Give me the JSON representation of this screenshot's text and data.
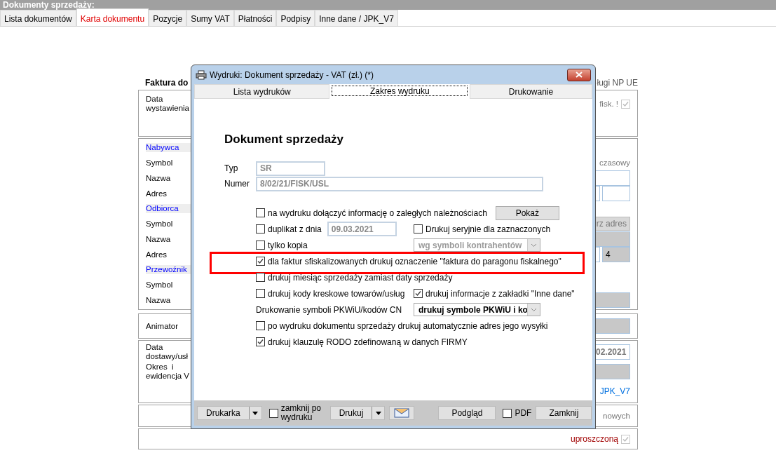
{
  "background": {
    "title": "Dokumenty sprzedaży:",
    "tabs": [
      {
        "label": "Lista dokumentów",
        "selected": false
      },
      {
        "label": "Karta dokumentu",
        "selected": true
      },
      {
        "label": "Pozycje",
        "selected": false
      },
      {
        "label": "Sumy VAT",
        "selected": false
      },
      {
        "label": "Płatności",
        "selected": false
      },
      {
        "label": "Podpisy",
        "selected": false
      },
      {
        "label": "Inne dane / JPK_V7",
        "selected": false
      }
    ],
    "form_title": "Faktura do",
    "form_note": "ługi NP UE",
    "groups": [
      {
        "rows": [
          {
            "label": "Data wystawienia",
            "right": {
              "kind": "check",
              "text": "fisk. !",
              "checked": true
            }
          }
        ]
      },
      {
        "rows": [
          {
            "label": "Nabywca",
            "heading": true
          },
          {
            "label": "Symbol",
            "right": {
              "kind": "text",
              "text": "czasowy"
            }
          },
          {
            "label": "Nazwa",
            "right": {
              "kind": "field"
            }
          },
          {
            "label": "Adres",
            "right": {
              "kind": "pair"
            }
          },
          {
            "label": "Odbiorca",
            "heading": true
          },
          {
            "label": "Symbol",
            "right": {
              "kind": "button",
              "text": "rz adres"
            }
          },
          {
            "label": "Nazwa",
            "right": {
              "kind": "gray"
            }
          },
          {
            "label": "Adres",
            "right": {
              "kind": "pair",
              "text": "4"
            }
          },
          {
            "label": "Przewoźnik",
            "heading": true
          },
          {
            "label": "Symbol"
          },
          {
            "label": "Nazwa",
            "right": {
              "kind": "gray"
            }
          }
        ]
      },
      {
        "rows": [
          {
            "label": "Animator",
            "right": {
              "kind": "gray"
            }
          }
        ]
      },
      {
        "rows": [
          {
            "label": "Data dostawy/usł",
            "right": {
              "kind": "field",
              "text": "02.2021"
            }
          },
          {
            "label": "Okres  i ewidencja V",
            "right": {
              "kind": "dropdown"
            }
          },
          {
            "right": {
              "kind": "link",
              "text": "JPK_V7"
            }
          }
        ]
      },
      {
        "rows": [
          {
            "right": {
              "kind": "text",
              "text": "nowych"
            }
          }
        ]
      },
      {
        "rows": [
          {
            "right": {
              "kind": "check",
              "text": "uproszczoną",
              "checked": true,
              "alert": true
            }
          }
        ]
      }
    ]
  },
  "dialog": {
    "title": "Wydruki: Dokument sprzedaży - VAT (zł.)  (*)",
    "tabs": [
      {
        "label": "Lista wydruków",
        "selected": false
      },
      {
        "label": "Zakres wydruku",
        "selected": true
      },
      {
        "label": "Drukowanie",
        "selected": false
      }
    ],
    "heading": "Dokument sprzedaży",
    "fields": [
      {
        "label": "Typ",
        "value": "SR",
        "wide": false
      },
      {
        "label": "Numer",
        "value": "8/02/21/FISK/USL",
        "wide": true
      }
    ],
    "options": [
      {
        "left": [
          {
            "kind": "checkbox",
            "text": "na wydruku dołączyć informację o zaległych należnościach",
            "checked": false
          }
        ],
        "right": {
          "kind": "button",
          "text": "Pokaż"
        }
      },
      {
        "left": [
          {
            "kind": "checkbox",
            "text": "duplikat z dnia",
            "checked": false
          },
          {
            "kind": "field",
            "text": "09.03.2021"
          }
        ],
        "right": {
          "kind": "checkbox",
          "text": "Drukuj seryjnie dla zaznaczonych",
          "checked": false
        }
      },
      {
        "left": [
          {
            "kind": "checkbox",
            "text": "tylko kopia",
            "checked": false
          }
        ],
        "right": {
          "kind": "dropdown",
          "text": "wg symboli kontrahentów",
          "disabled": true
        }
      },
      {
        "left": [
          {
            "kind": "checkbox",
            "text": "dla faktur sfiskalizowanych drukuj oznaczenie \"faktura do paragonu fiskalnego\"",
            "checked": true
          }
        ],
        "highlighted": true
      },
      {
        "left": [
          {
            "kind": "checkbox",
            "text": "drukuj miesiąc sprzedaży zamiast daty sprzedaży",
            "checked": false
          }
        ]
      },
      {
        "left": [
          {
            "kind": "checkbox",
            "text": "drukuj kody kreskowe towarów/usług",
            "checked": false
          }
        ],
        "right": {
          "kind": "checkbox",
          "text": "drukuj informacje z zakładki \"Inne dane\"",
          "checked": true
        }
      },
      {
        "left": [
          {
            "kind": "label",
            "text": "Drukowanie symboli PKWiU/kodów CN"
          }
        ],
        "right": {
          "kind": "dropdown",
          "text": "drukuj symbole PKWiU i ko",
          "disabled": false
        }
      },
      {
        "left": [
          {
            "kind": "checkbox",
            "text": "po wydruku dokumentu sprzedaży drukuj automatycznie adres jego wysyłki",
            "checked": false
          }
        ]
      },
      {
        "left": [
          {
            "kind": "checkbox",
            "text": "drukuj klauzulę RODO zdefinowaną w danych FIRMY",
            "checked": true
          }
        ]
      }
    ],
    "footer": [
      {
        "kind": "split",
        "text": "Drukarka"
      },
      {
        "kind": "checkbox",
        "text": "zamknij po wydruku",
        "checked": false
      },
      {
        "kind": "split",
        "text": "Drukuj"
      },
      {
        "kind": "mail"
      },
      {
        "kind": "button",
        "text": "Podgląd"
      },
      {
        "kind": "checkbox",
        "text": "PDF",
        "checked": false
      },
      {
        "kind": "button",
        "text": "Zamknij"
      }
    ]
  }
}
